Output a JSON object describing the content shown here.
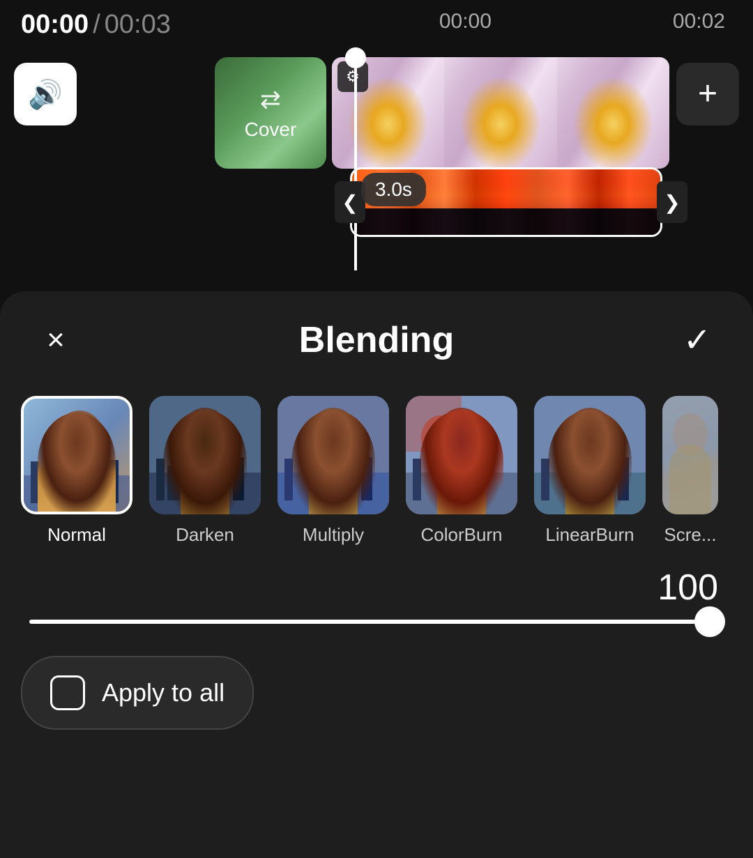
{
  "timeline": {
    "current_time": "00:00",
    "separator": "/",
    "total_time": "00:03",
    "markers": [
      "00:00",
      "00:02"
    ],
    "duration_badge": "3.0s"
  },
  "cover": {
    "label": "Cover",
    "icon": "⇄"
  },
  "controls": {
    "volume_icon": "🔊",
    "add_icon": "+",
    "chevron_left": "❮",
    "chevron_right": "❯"
  },
  "panel": {
    "title": "Blending",
    "close_label": "×",
    "confirm_label": "✓"
  },
  "blend_modes": [
    {
      "id": "normal",
      "label": "Normal",
      "selected": true
    },
    {
      "id": "darken",
      "label": "Darken",
      "selected": false
    },
    {
      "id": "multiply",
      "label": "Multiply",
      "selected": false
    },
    {
      "id": "colorburn",
      "label": "ColorBurn",
      "selected": false
    },
    {
      "id": "linearburn",
      "label": "LinearBurn",
      "selected": false
    },
    {
      "id": "screen",
      "label": "Scre...",
      "selected": false
    }
  ],
  "opacity": {
    "value": "100",
    "slider_percent": 96
  },
  "apply_to_all": {
    "label": "Apply to all",
    "checked": false
  }
}
